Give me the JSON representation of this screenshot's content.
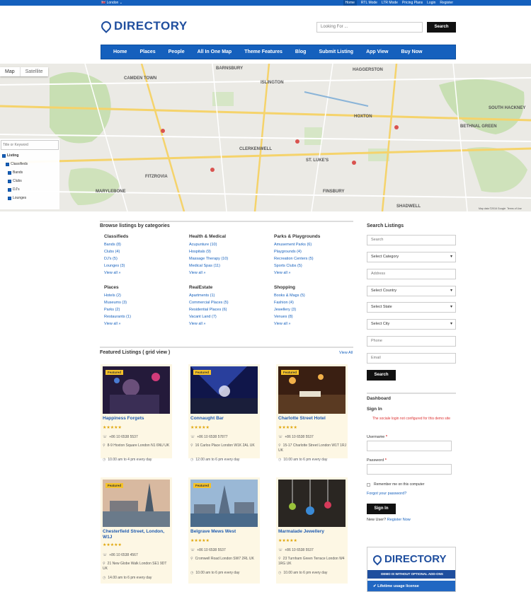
{
  "topbar": {
    "location": "🇬🇧 London ⌄",
    "links": [
      "Home",
      "RTL Mode",
      "LTR Mode",
      "Pricing Plans",
      "Login",
      "Register"
    ]
  },
  "header": {
    "logo_text": "DIRECTORY",
    "search_placeholder": "Looking For ...",
    "search_button": "Search"
  },
  "nav": {
    "items": [
      "Home",
      "Places",
      "People",
      "All In One Map",
      "Theme Features",
      "Blog",
      "Submit Listing",
      "App View",
      "Buy Now"
    ]
  },
  "map": {
    "tab_map": "Map",
    "tab_satellite": "Satellite",
    "keyword_placeholder": "Title or Keyword",
    "filters": [
      "Listing",
      "Classifieds",
      "Bands",
      "Clubs",
      "DJ's",
      "Lounges"
    ],
    "attribution": "Map data ©2016 Google",
    "terms": "Terms of Use",
    "labels": [
      "CAMDEN TOWN",
      "BARNSBURY",
      "ISLINGTON",
      "HAGGERSTON",
      "BETHNAL GREEN",
      "CLERKENWELL",
      "ST. LUKE'S",
      "FITZROVIA",
      "MARYLEBONE",
      "FINSBURY",
      "SHADWELL",
      "SOUTH HACKNEY",
      "HOXTON"
    ]
  },
  "categories": {
    "title": "Browse listings by categories",
    "groups": [
      {
        "name": "Classifieds",
        "items": [
          "Bands (8)",
          "Clubs (4)",
          "DJ's (5)",
          "Lounges (3)",
          "View all »"
        ]
      },
      {
        "name": "Health & Medical",
        "items": [
          "Acupunture (10)",
          "Hospitals (9)",
          "Massage Therapy (10)",
          "Medical Spas (11)",
          "View all »"
        ]
      },
      {
        "name": "Parks & Playgrounds",
        "items": [
          "Amusement Parks (6)",
          "Playgrounds (4)",
          "Recreation Centers (5)",
          "Sports Clubs (5)",
          "View all »"
        ]
      },
      {
        "name": "Places",
        "items": [
          "Hotels (2)",
          "Museums (3)",
          "Parks (2)",
          "Restaurants (1)",
          "View all »"
        ]
      },
      {
        "name": "RealEstate",
        "items": [
          "Apartments (1)",
          "Commercial Places (5)",
          "Residential Places (6)",
          "Vacant Land (7)",
          "View all »"
        ]
      },
      {
        "name": "Shopping",
        "items": [
          "Books & Mags (5)",
          "Fashion (4)",
          "Jewellery (3)",
          "Venues (8)",
          "View all »"
        ]
      }
    ]
  },
  "featured": {
    "title": "Featured Listings ( grid view )",
    "view_all": "View All",
    "badge": "Featured",
    "stars": "★★★★★",
    "listings": [
      {
        "title": "Happiness Forgets",
        "phone": "+86 10 6538 5537",
        "address": "8-9 Hoxton Square London N1 6NU UK",
        "hours": "10.00 am to 4 pm every day",
        "featured": true
      },
      {
        "title": "Connaught Bar",
        "phone": "+86 10 6538 57877",
        "address": "16 Carlos Place London W1K 2AL UK",
        "hours": "12.00 am to 6 pm every day",
        "featured": true
      },
      {
        "title": "Charlotte Street Hotel",
        "phone": "+86 10 6538 5537",
        "address": "15-17 Charlotte Street London W1T 1RJ UK",
        "hours": "10.00 am to 6 pm every day",
        "featured": true
      },
      {
        "title": "Chesterfield Street, London, W1J",
        "phone": "+86 10 6538 4567",
        "address": "21 New Globe Walk London SE1 9DT UK",
        "hours": "14.00 am to 6 pm every day",
        "featured": true
      },
      {
        "title": "Belgrave Mews West",
        "phone": "+86 10 6538 5537",
        "address": "Cromwell Road London SW7 2RL UK",
        "hours": "10.00 am to 6 pm every day",
        "featured": true
      },
      {
        "title": "Marmalade Jewellery",
        "phone": "+86 10 6538 5537",
        "address": "23 Turnham Green Terrace London W4 1RG UK",
        "hours": "10.00 am to 6 pm every day",
        "featured": false
      }
    ]
  },
  "search_listings": {
    "title": "Search Listings",
    "search_placeholder": "Search",
    "category": "Select Category",
    "address_placeholder": "Address",
    "country": "Select Country",
    "state": "Select State",
    "city": "Select City",
    "phone_placeholder": "Phone",
    "email_placeholder": "Email",
    "button": "Search"
  },
  "dashboard": {
    "title": "Dashboard",
    "signin_title": "Sign In",
    "notice": "The sociale login not configured for this demo site",
    "username_label": "Username",
    "password_label": "Password",
    "required": "*",
    "remember": "Remember me on this computer",
    "forgot": "Forgot your password?",
    "signin_button": "Sign In",
    "new_user": "New User?",
    "register": "Register Now"
  },
  "promo": {
    "logo_text": "DIRECTORY",
    "strip": "DEMO IS WITHOUT OPTIONAL ADD-ONS",
    "lifetime": "✔ Lifetime usage license"
  }
}
